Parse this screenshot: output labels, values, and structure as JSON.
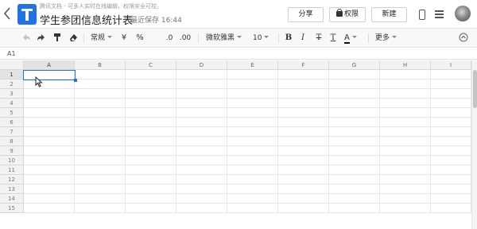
{
  "header": {
    "subtitle": "腾讯文档 - 可多人实时在线编辑，权限安全可控。",
    "title": "学生参团信息统计表",
    "save_status": "最近保存 16:44",
    "share_label": "分享",
    "permission_label": "权限",
    "new_label": "新建"
  },
  "toolbar": {
    "format_label": "常规",
    "currency_label": "¥",
    "percent_label": "%",
    "decrease_decimal_label": ".0",
    "increase_decimal_label": ".00",
    "font_label": "微软雅黑",
    "font_size_label": "10",
    "bold_label": "B",
    "italic_label": "I",
    "strike_label": "T",
    "underline_label": "T",
    "font_color_label": "A",
    "more_label": "更多"
  },
  "namebar": {
    "cell_ref": "A1"
  },
  "grid": {
    "columns": [
      "A",
      "B",
      "C",
      "D",
      "E",
      "F",
      "G",
      "H",
      "I"
    ],
    "rows": [
      "1",
      "2",
      "3",
      "4",
      "5",
      "6",
      "7",
      "8",
      "9",
      "10",
      "11",
      "12",
      "13",
      "14",
      "15"
    ],
    "active_cell": "A1"
  },
  "icons": {
    "back": "chevron-left-icon",
    "logo": "tencent-docs-logo",
    "undo": "undo-icon",
    "redo": "redo-icon",
    "format_painter": "paint-format-icon",
    "clear_format": "eraser-icon",
    "permission": "lock-icon",
    "phone": "phone-icon",
    "menu": "hamburger-menu-icon",
    "avatar": "user-avatar"
  },
  "colors": {
    "accent": "#1f73e6"
  }
}
